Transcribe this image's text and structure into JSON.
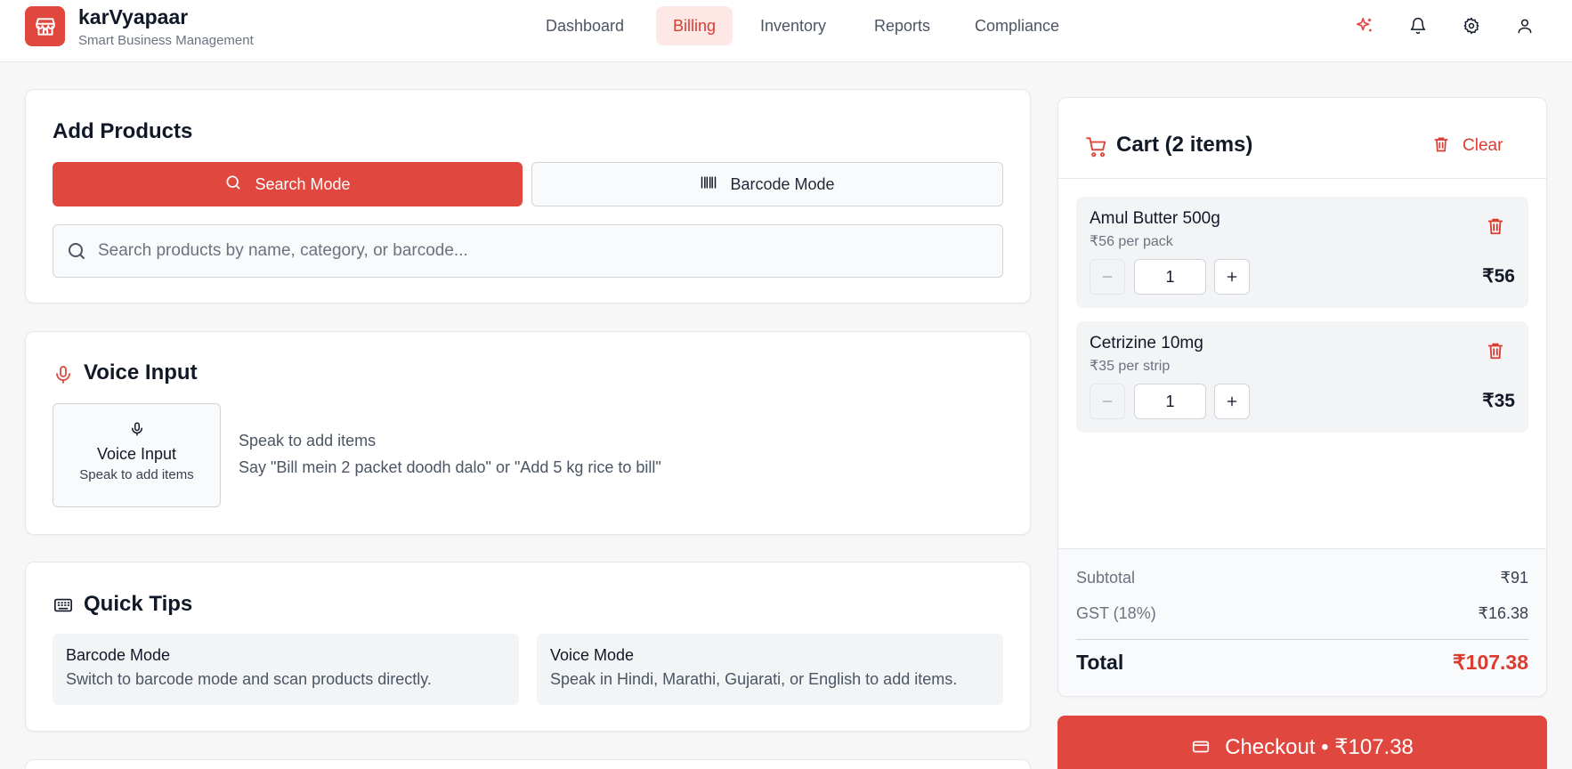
{
  "brand": {
    "name": "karVyapaar",
    "subtitle": "Smart Business Management"
  },
  "nav": {
    "tabs": [
      {
        "label": "Dashboard",
        "active": false
      },
      {
        "label": "Billing",
        "active": true
      },
      {
        "label": "Inventory",
        "active": false
      },
      {
        "label": "Reports",
        "active": false
      },
      {
        "label": "Compliance",
        "active": false
      }
    ],
    "icons": [
      "sparkles-icon",
      "bell-icon",
      "gear-icon",
      "user-icon"
    ]
  },
  "add_products": {
    "title": "Add Products",
    "search_mode_label": "Search Mode",
    "barcode_mode_label": "Barcode Mode",
    "active_mode": "search",
    "search": {
      "placeholder": "Search products by name, category, or barcode...",
      "value": ""
    }
  },
  "voice_input": {
    "title": "Voice Input",
    "tile_title": "Voice Input",
    "tile_sub": "Speak to add items",
    "hint_title": "Speak to add items",
    "hint_example": "Say \"Bill mein 2 packet doodh dalo\" or \"Add 5 kg rice to bill\""
  },
  "quick_tips": {
    "title": "Quick Tips",
    "tips": [
      {
        "title": "Barcode Mode",
        "desc": "Switch to barcode mode and scan products directly."
      },
      {
        "title": "Voice Mode",
        "desc": "Speak in Hindi, Marathi, Gujarati, or English to add items."
      }
    ]
  },
  "cart": {
    "title": "Cart (2 items)",
    "clear_label": "Clear",
    "items": [
      {
        "name": "Amul Butter 500g",
        "unit_price": "₹56 per pack",
        "qty": "1",
        "total": "₹56"
      },
      {
        "name": "Cetrizine 10mg",
        "unit_price": "₹35 per strip",
        "qty": "1",
        "total": "₹35"
      }
    ],
    "subtotal_label": "Subtotal",
    "subtotal": "₹91",
    "gst_label": "GST (18%)",
    "gst": "₹16.38",
    "total_label": "Total",
    "total": "₹107.38"
  },
  "checkout": {
    "label": "Checkout • ₹107.38"
  },
  "colors": {
    "accent": "#e0483f",
    "accent_light": "#fde8e6",
    "text": "#111827",
    "muted": "#6b7280"
  }
}
